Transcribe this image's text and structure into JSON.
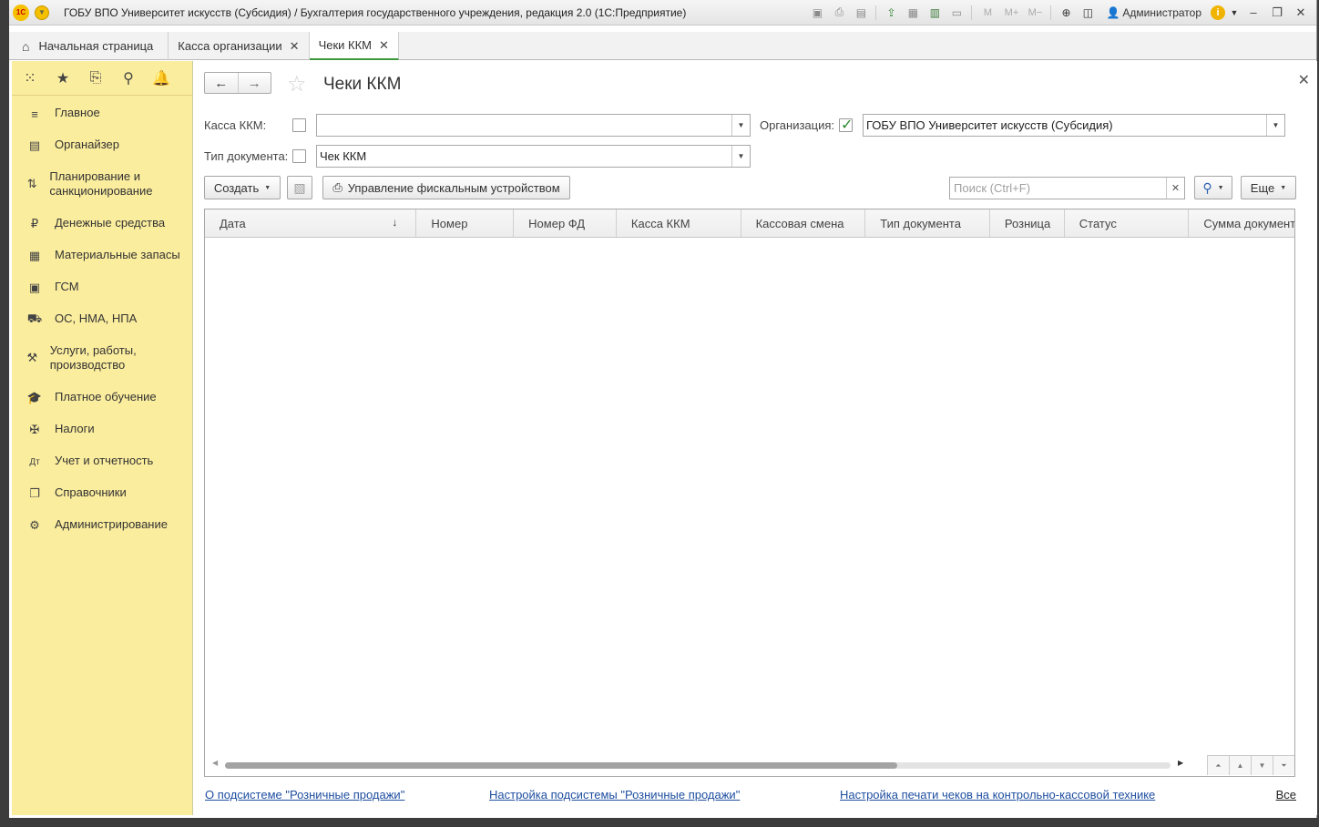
{
  "window": {
    "title": "ГОБУ ВПО Университет искусств (Субсидия) / Бухгалтерия государственного учреждения, редакция 2.0  (1С:Предприятие)",
    "logo": "1С",
    "user": "Администратор",
    "m_labels": [
      "M",
      "M+",
      "M−"
    ]
  },
  "tabs": [
    {
      "label": "Начальная страница",
      "icon": "home-icon"
    },
    {
      "label": "Касса организации"
    },
    {
      "label": "Чеки ККМ"
    }
  ],
  "sidebar": {
    "items": [
      {
        "label": "Главное",
        "icon": "menu-lines-icon"
      },
      {
        "label": "Органайзер",
        "icon": "organizer-icon"
      },
      {
        "label": "Планирование и санкционирование",
        "icon": "planning-icon"
      },
      {
        "label": "Денежные средства",
        "icon": "ruble-icon"
      },
      {
        "label": "Материальные запасы",
        "icon": "grid-blocks-icon"
      },
      {
        "label": "ГСМ",
        "icon": "fuel-icon"
      },
      {
        "label": "ОС, НМА, НПА",
        "icon": "truck-icon"
      },
      {
        "label": "Услуги, работы, производство",
        "icon": "tools-icon"
      },
      {
        "label": "Платное обучение",
        "icon": "graduation-cap-icon"
      },
      {
        "label": "Налоги",
        "icon": "emblem-icon"
      },
      {
        "label": "Учет и отчетность",
        "icon": "debit-credit-icon"
      },
      {
        "label": "Справочники",
        "icon": "books-icon"
      },
      {
        "label": "Администрирование",
        "icon": "gear-icon"
      }
    ]
  },
  "form": {
    "title": "Чеки ККМ",
    "filters": {
      "kassa_label": "Касса ККМ:",
      "kassa_value": "",
      "kassa_checked": false,
      "org_label": "Организация:",
      "org_value": "ГОБУ ВПО Университет искусств (Субсидия)",
      "org_checked": true,
      "doctype_label": "Тип документа:",
      "doctype_value": "Чек ККМ",
      "doctype_checked": false
    },
    "toolbar": {
      "create_label": "Создать",
      "fiscal_label": "Управление фискальным устройством",
      "search_placeholder": "Поиск (Ctrl+F)",
      "more_label": "Еще"
    },
    "table": {
      "columns": [
        "Дата",
        "Номер",
        "Номер ФД",
        "Касса ККМ",
        "Кассовая смена",
        "Тип документа",
        "Розница",
        "Статус",
        "Сумма документа"
      ],
      "sorted_column": "Дата",
      "rows": []
    },
    "links": {
      "about": "О подсистеме \"Розничные продажи\"",
      "settings": "Настройка подсистемы \"Розничные продажи\"",
      "print_settings": "Настройка печати чеков на контрольно-кассовой технике",
      "all": "Все"
    }
  }
}
